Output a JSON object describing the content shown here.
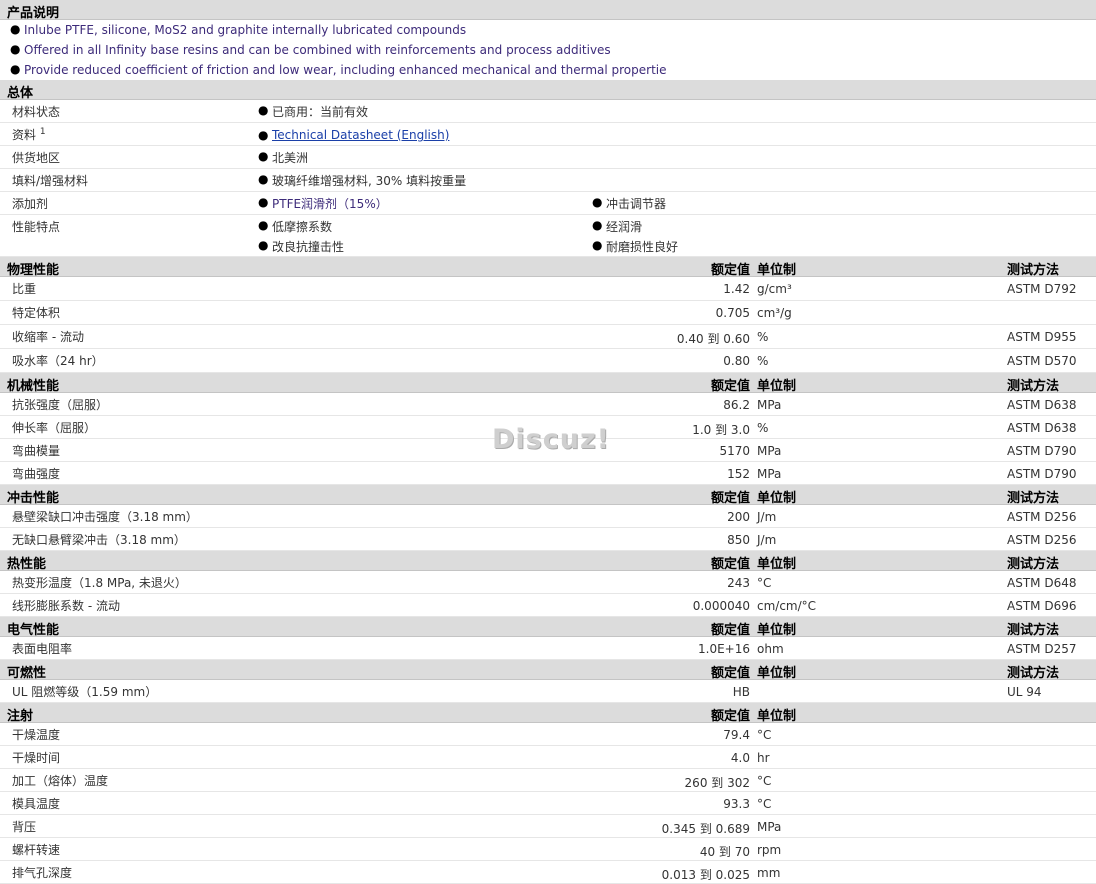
{
  "product": {
    "title": "产品说明",
    "bullets": [
      "Inlube PTFE, silicone, MoS2 and graphite internally lubricated compounds",
      "Offered in all Infinity base resins and can be combined with reinforcements and process additives",
      "Provide reduced coefficient of friction and low wear, including enhanced mechanical and thermal propertie"
    ]
  },
  "general": {
    "title": "总体",
    "status_label": "材料状态",
    "status_value": "已商用：当前有效",
    "doc_label": "资料",
    "doc_sup": "1",
    "doc_link": "Technical Datasheet (English)",
    "region_label": "供货地区",
    "region_value": "北美洲",
    "filler_label": "填料/增强材料",
    "filler_value": "玻璃纤维增强材料, 30% 填料按重量",
    "additive_label": "添加剂",
    "additive_1": "PTFE润滑剂（15%）",
    "additive_2": "冲击调节器",
    "feature_label": "性能特点",
    "features": [
      "低摩擦系数",
      "经润滑",
      "改良抗撞击性",
      "耐磨损性良好"
    ]
  },
  "headers": {
    "nominal": "额定值",
    "unit": "单位制",
    "test": "测试方法"
  },
  "physical": {
    "title": "物理性能",
    "rows": [
      {
        "label": "比重",
        "value": "1.42",
        "unit": "g/cm³",
        "test": "ASTM D792"
      },
      {
        "label": "特定体积",
        "value": "0.705",
        "unit": "cm³/g",
        "test": ""
      },
      {
        "label": "收缩率  - 流动",
        "value": "0.40 到  0.60",
        "unit": "%",
        "test": "ASTM D955"
      },
      {
        "label": "吸水率（24 hr）",
        "value": "0.80",
        "unit": "%",
        "test": "ASTM D570"
      }
    ]
  },
  "mechanical": {
    "title": "机械性能",
    "rows": [
      {
        "label": "抗张强度（屈服）",
        "value": "86.2",
        "unit": "MPa",
        "test": "ASTM D638"
      },
      {
        "label": "伸长率（屈服）",
        "value": "1.0 到  3.0",
        "unit": "%",
        "test": "ASTM D638"
      },
      {
        "label": "弯曲模量",
        "value": "5170",
        "unit": "MPa",
        "test": "ASTM D790"
      },
      {
        "label": "弯曲强度",
        "value": "152",
        "unit": "MPa",
        "test": "ASTM D790"
      }
    ]
  },
  "impact": {
    "title": "冲击性能",
    "rows": [
      {
        "label": "悬壁梁缺口冲击强度（3.18 mm）",
        "value": "200",
        "unit": "J/m",
        "test": "ASTM D256"
      },
      {
        "label": "无缺口悬臂梁冲击（3.18 mm）",
        "value": "850",
        "unit": "J/m",
        "test": "ASTM D256"
      }
    ]
  },
  "thermal": {
    "title": "热性能",
    "rows": [
      {
        "label": "热变形温度（1.8 MPa, 未退火）",
        "value": "243",
        "unit": "°C",
        "test": "ASTM D648"
      },
      {
        "label": "线形膨胀系数  - 流动",
        "value": "0.000040",
        "unit": "cm/cm/°C",
        "test": "ASTM D696"
      }
    ]
  },
  "electrical": {
    "title": "电气性能",
    "rows": [
      {
        "label": "表面电阻率",
        "value": "1.0E+16",
        "unit": "ohm",
        "test": "ASTM D257"
      }
    ]
  },
  "flammability": {
    "title": "可燃性",
    "rows": [
      {
        "label": "UL 阻燃等级（1.59 mm）",
        "value": "HB",
        "unit": "",
        "test": "UL 94"
      }
    ]
  },
  "injection": {
    "title": "注射",
    "rows": [
      {
        "label": "干燥温度",
        "value": "79.4",
        "unit": "°C"
      },
      {
        "label": "干燥时间",
        "value": "4.0",
        "unit": "hr"
      },
      {
        "label": "加工（熔体）温度",
        "value": "260 到  302",
        "unit": "°C"
      },
      {
        "label": "模具温度",
        "value": "93.3",
        "unit": "°C"
      },
      {
        "label": "背压",
        "value": "0.345 到  0.689",
        "unit": "MPa"
      },
      {
        "label": "螺杆转速",
        "value": "40 到  70",
        "unit": "rpm"
      },
      {
        "label": "排气孔深度",
        "value": "0.013 到  0.025",
        "unit": "mm"
      }
    ]
  },
  "watermark": "Discuz!"
}
